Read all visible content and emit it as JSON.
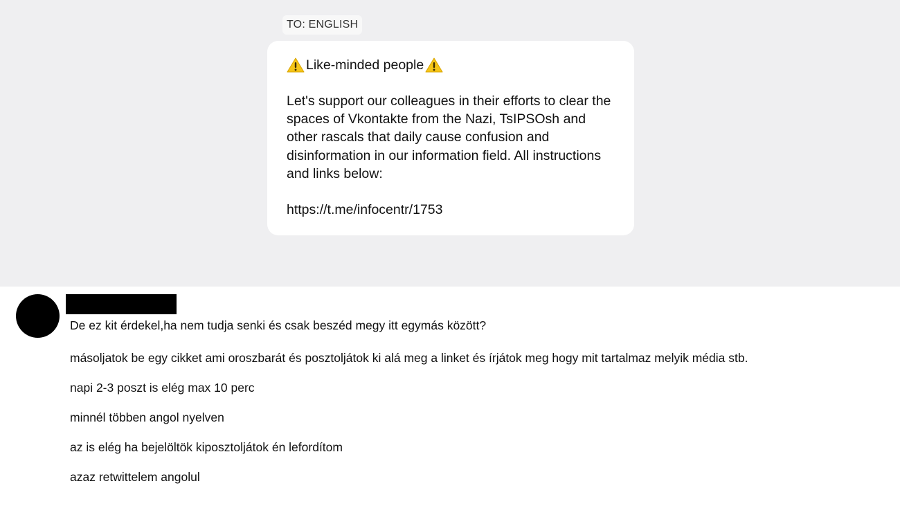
{
  "translation": {
    "label": "TO: ENGLISH",
    "title": "Like-minded people",
    "title_icons": [
      "warning-icon",
      "warning-icon"
    ],
    "warning_color": "#f5c518",
    "body": "Let's support our colleagues in their efforts to clear the spaces of Vkontakte from the Nazi, TsIPSOsh and other rascals that daily cause confusion and disinformation in our information field. All instructions and links below:",
    "link": "https://t.me/infocentr/1753"
  },
  "chat": {
    "messages": [
      "De ez kit érdekel,ha nem tudja senki és csak beszéd megy itt egymás között?",
      "másoljatok be egy cikket ami oroszbarát és posztoljátok ki alá meg a linket és írjátok meg hogy mit tartalmaz melyik média stb.",
      "napi 2-3 poszt is elég max 10 perc",
      "minnél többen angol nyelven",
      "az is elég ha bejelöltök kiposztoljátok én lefordítom",
      "azaz retwittelem angolul"
    ]
  }
}
